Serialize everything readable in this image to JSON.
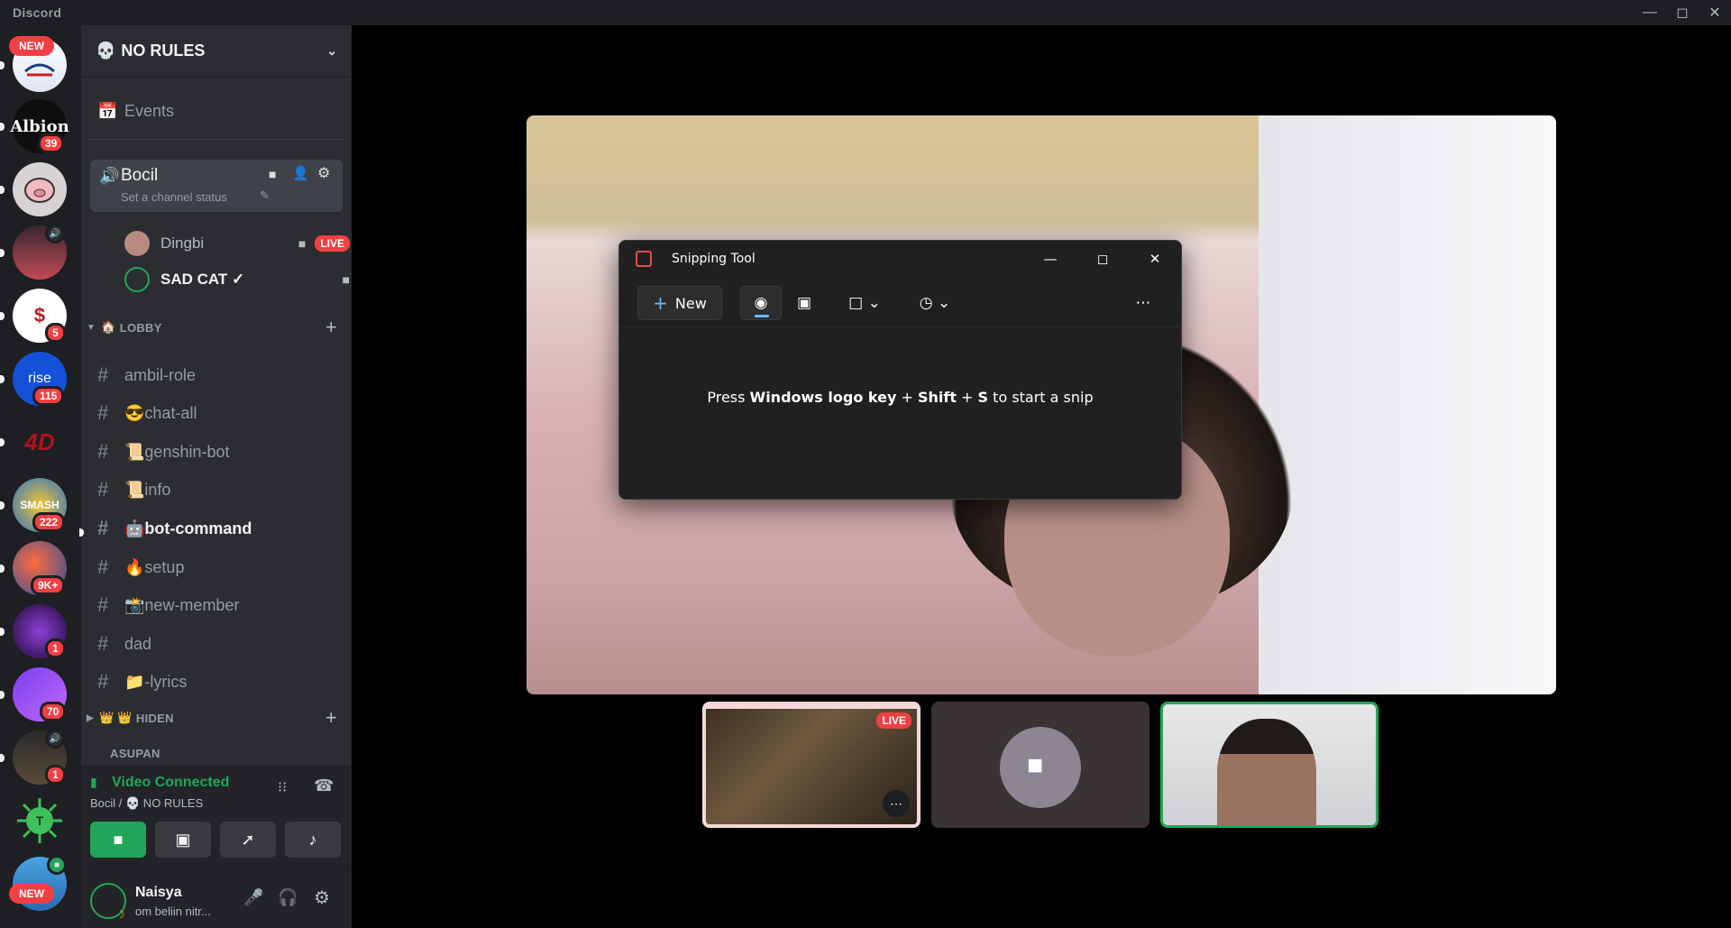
{
  "window": {
    "title": "Discord"
  },
  "rail": {
    "badges": [
      "NEW",
      "39",
      "5",
      "115",
      "222",
      "9K+",
      "1",
      "70",
      "1",
      "NEW"
    ],
    "server_labels": [
      "Albion",
      "rise",
      "4D",
      "SMASH",
      "T"
    ]
  },
  "server": {
    "name": "NO RULES"
  },
  "sidebar": {
    "events_label": "Events",
    "voice_channel": {
      "name": "Bocil",
      "status_placeholder": "Set a channel status"
    },
    "voice_users": [
      {
        "name": "Dingbi",
        "badge": "LIVE"
      },
      {
        "name": "SAD CAT ✓"
      }
    ],
    "categories": {
      "lobby": "LOBBY",
      "hiden": "HIDEN",
      "next": "ASUPAN"
    },
    "channels": [
      {
        "name": "ambil-role",
        "emoji": ""
      },
      {
        "name": "chat-all",
        "emoji": "😎"
      },
      {
        "name": "genshin-bot",
        "emoji": "📜"
      },
      {
        "name": "info",
        "emoji": "📜"
      },
      {
        "name": "bot-command",
        "emoji": "🤖"
      },
      {
        "name": "setup",
        "emoji": "🔥"
      },
      {
        "name": "new-member",
        "emoji": "📸"
      },
      {
        "name": "dad",
        "emoji": ""
      },
      {
        "name": "-lyrics",
        "emoji": "📁"
      }
    ]
  },
  "voice_panel": {
    "status": "Video Connected",
    "location": "Bocil / 💀 NO RULES"
  },
  "user_panel": {
    "name": "Naisya",
    "status": "om beliin nitr..."
  },
  "snipping_tool": {
    "title": "Snipping Tool",
    "new_label": "New",
    "msg_prefix": "Press ",
    "msg_key1": "Windows logo key",
    "msg_plus1": " + ",
    "msg_key2": "Shift",
    "msg_plus2": " + ",
    "msg_key3": "S",
    "msg_suffix": " to start a snip"
  },
  "stream_tiles": {
    "live_badge": "LIVE"
  },
  "colors": {
    "live": "#f23f43",
    "connected": "#23a559",
    "accent": "#5865f2"
  }
}
